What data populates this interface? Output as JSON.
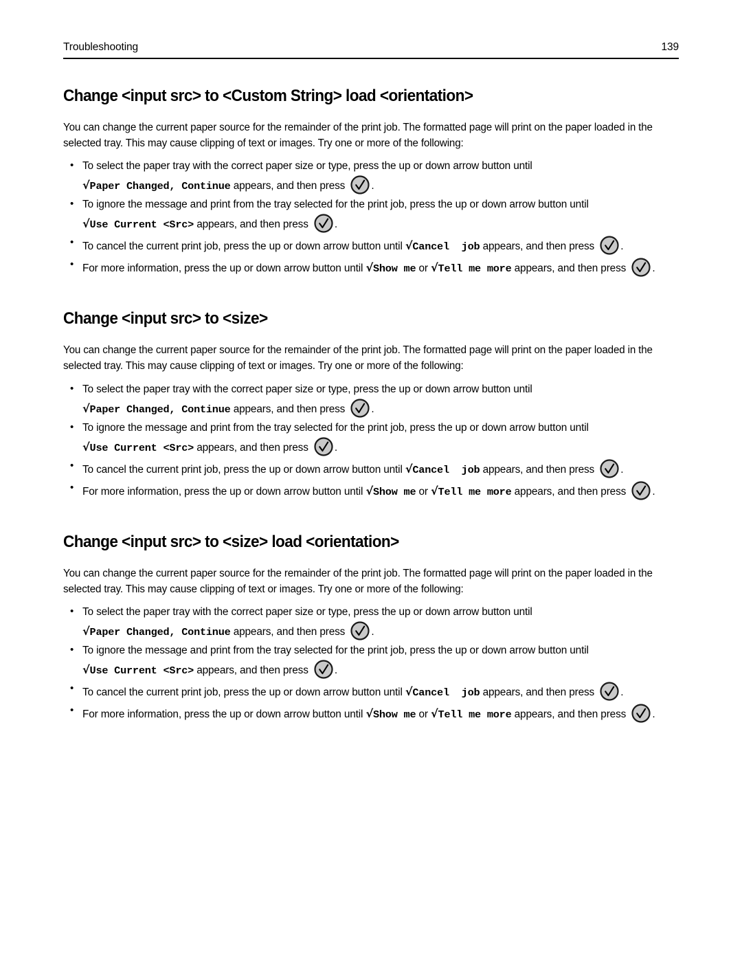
{
  "header": {
    "title": "Troubleshooting",
    "page_number": "139"
  },
  "icons": {
    "select_button": "check-circle-button-icon",
    "bullet": "bullet-icon",
    "radical_glyph": "√"
  },
  "intro_paragraph": "You can change the current paper source for the remainder of the print job. The formatted page will print on the paper loaded in the selected tray. This may cause clipping of text or images. Try one or more of the following:",
  "bullets": {
    "b1": {
      "part1": "To select the paper tray with the correct paper size or type, press the up or down arrow button until ",
      "mono1": "Paper Changed, Continue",
      "part2": " appears, and then press ",
      "part3": "."
    },
    "b2": {
      "part1": "To ignore the message and print from the tray selected for the print job, press the up or down arrow button until ",
      "mono1": "Use Current <Src>",
      "part2": " appears, and then press ",
      "part3": "."
    },
    "b3": {
      "part1": "To cancel the current print job, press the up or down arrow button until ",
      "mono1": "Cancel  job",
      "part2": " appears, and then press ",
      "part3": "."
    },
    "b4": {
      "part1": "For more information, press the up or down arrow button until ",
      "mono1": "Show me",
      "part2": " or ",
      "mono2": "Tell me more",
      "part3": " appears, and then press ",
      "part4": "."
    }
  },
  "sections": [
    {
      "heading": "Change <input src> to <Custom String> load <orientation>"
    },
    {
      "heading": "Change <input src> to <size>"
    },
    {
      "heading": "Change <input src> to <size> load <orientation>"
    }
  ],
  "colors": {
    "text": "#000000",
    "page_background": "#ffffff",
    "icon_fill": "#c9c9c9",
    "icon_stroke": "#1a1a1a"
  }
}
